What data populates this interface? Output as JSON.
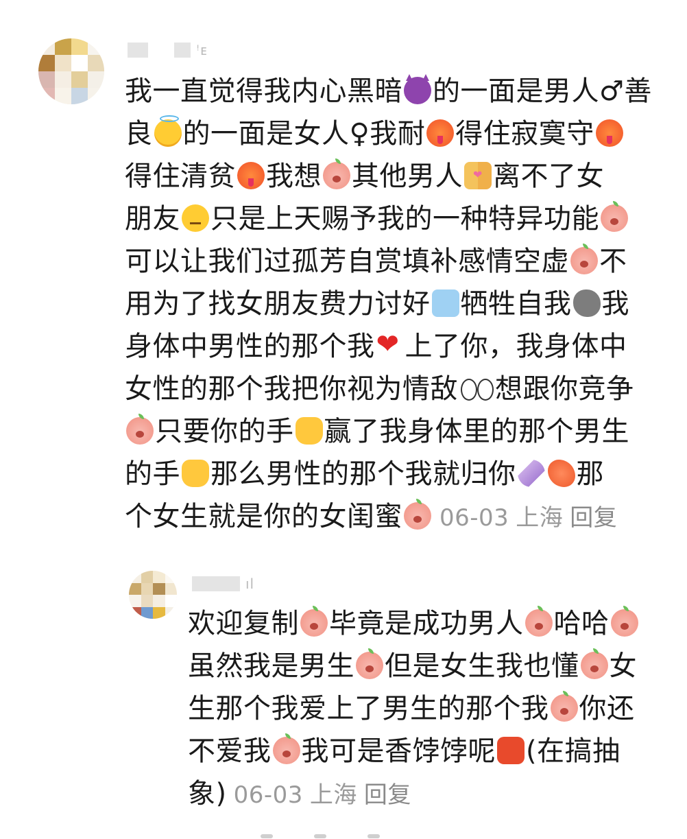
{
  "main_comment": {
    "username_tail": "ꜝᴇ",
    "lines": [
      [
        {
          "t": "我一直觉得我内心黑暗"
        },
        {
          "e": "devil-emoji",
          "c": "devil"
        },
        {
          "t": "的一面是男人♂善"
        }
      ],
      [
        {
          "t": "良"
        },
        {
          "e": "angel-emoji",
          "c": "angel"
        },
        {
          "t": "的一面是女人♀我耐"
        },
        {
          "e": "hot-face-emoji",
          "c": "hot"
        },
        {
          "t": "得住寂寞守"
        },
        {
          "e": "hot-face-emoji",
          "c": "hot"
        }
      ],
      [
        {
          "t": "得住清贫"
        },
        {
          "e": "hot-face-emoji",
          "c": "hot"
        },
        {
          "t": "我想"
        },
        {
          "e": "peach-shocked-emoji",
          "c": "peach"
        },
        {
          "t": "其他男人"
        },
        {
          "e": "couple-emoji",
          "c": "couple"
        },
        {
          "t": "离不了女"
        }
      ],
      [
        {
          "t": "朋友"
        },
        {
          "e": "unamused-emoji",
          "c": "unamused"
        },
        {
          "t": "只是上天赐予我的一种特异功能"
        },
        {
          "e": "peach-glasses-emoji",
          "c": "peach"
        }
      ],
      [
        {
          "t": "可以让我们过孤芳自赏填补感情空虚"
        },
        {
          "e": "peach-phone-emoji",
          "c": "peach"
        },
        {
          "t": "不"
        }
      ],
      [
        {
          "t": "用为了找女朋友费力讨好"
        },
        {
          "e": "crying-emoji",
          "c": "cry-blue"
        },
        {
          "t": "牺牲自我"
        },
        {
          "e": "rock-emoji",
          "c": "rock"
        },
        {
          "t": "我"
        }
      ],
      [
        {
          "t": "身体中男性的那个我"
        },
        {
          "e": "heart-emoji",
          "c": "heart"
        },
        {
          "t": "上了你，我身体中"
        }
      ],
      [
        {
          "t": "女性的那个我把你视为情敌"
        },
        {
          "e": "eyes-emoji",
          "c": "eyes"
        },
        {
          "t": "想跟你竞争"
        }
      ],
      [
        {
          "e": "peach-covering-mouth-emoji",
          "c": "peach"
        },
        {
          "t": "只要你的手"
        },
        {
          "e": "hand-emoji",
          "c": "hand"
        },
        {
          "t": "赢了我身体里的那个男生"
        }
      ],
      [
        {
          "t": "的手"
        },
        {
          "e": "hand-emoji",
          "c": "hand"
        },
        {
          "t": "那么男性的那个我就归你"
        },
        {
          "e": "candy-emoji",
          "c": "candy"
        },
        {
          "e": "shrimp-emoji",
          "c": "shrimp"
        },
        {
          "t": "那"
        }
      ],
      [
        {
          "t": "个女生就是你的女闺蜜"
        },
        {
          "e": "peach-covering-mouth-emoji",
          "c": "peach"
        }
      ]
    ],
    "date": "06-03",
    "location": "上海",
    "reply_label": "回复"
  },
  "reply_comment": {
    "username_tail": "ıl",
    "lines": [
      [
        {
          "t": "欢迎复制"
        },
        {
          "e": "peach-phone-emoji",
          "c": "peach"
        },
        {
          "t": "毕竟是成功男人"
        },
        {
          "e": "peach-covering-mouth-emoji",
          "c": "peach"
        },
        {
          "t": "哈哈"
        },
        {
          "e": "peach-laughing-emoji",
          "c": "peach"
        }
      ],
      [
        {
          "t": "虽然我是男生"
        },
        {
          "e": "peach-shocked-emoji",
          "c": "peach"
        },
        {
          "t": "但是女生我也懂"
        },
        {
          "e": "peach-shy-emoji",
          "c": "peach"
        },
        {
          "t": "女"
        }
      ],
      [
        {
          "t": "生那个我爱上了男生的那个我"
        },
        {
          "e": "peach-kiss-emoji",
          "c": "peach"
        },
        {
          "t": "你还"
        }
      ],
      [
        {
          "t": "不爱我"
        },
        {
          "e": "peach-crying-emoji",
          "c": "peach"
        },
        {
          "t": "我可是香饽饽呢"
        },
        {
          "e": "angry-emoji",
          "c": "angry"
        },
        {
          "t": "(在搞抽"
        }
      ],
      [
        {
          "t": "象)"
        }
      ]
    ],
    "date": "06-03",
    "location": "上海",
    "reply_label": "回复"
  },
  "colors": {
    "text": "#1a1a1a",
    "meta": "#9a9a9a",
    "background": "#ffffff"
  }
}
